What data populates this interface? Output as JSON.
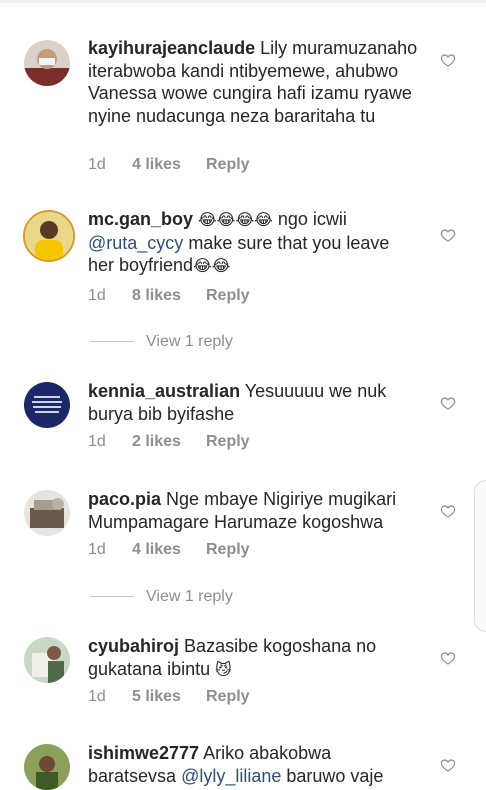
{
  "comments": [
    {
      "username": "kayihurajeanclaude",
      "segments": [
        "Lily muramuzanaho iterabwoba kandi ntibyemewe, ahubwo Vanessa wowe cungira hafi izamu ryawe nyine nudacunga neza bararitaha tu"
      ],
      "time": "1d",
      "likes": "4 likes",
      "reply": "Reply",
      "avatar_color": "#b9b1a6"
    },
    {
      "username": "mc.gan_boy",
      "emoji_a": "😂😂😂😂",
      "text_a": " ngo icwii ",
      "mention": "@ruta_cycy",
      "text_b": " make sure that you leave her boyfriend",
      "emoji_b": "😂😂",
      "time": "1d",
      "likes": "8 likes",
      "reply": "Reply",
      "avatar_color": "#f5c518"
    },
    {
      "username": "kennia_australian",
      "text": "Yesuuuuu we nuk burya bib byifashe",
      "time": "1d",
      "likes": "2 likes",
      "reply": "Reply",
      "avatar_color": "#1b2766"
    },
    {
      "username": "paco.pia",
      "text": "Nge mbaye Nigiriye  mugikari Mumpamagare Harumaze  kogoshwa",
      "time": "1d",
      "likes": "4 likes",
      "reply": "Reply",
      "avatar_color": "#8c8f95"
    },
    {
      "username": "cyubahiroj",
      "text": "Bazasibe kogoshana no gukatana ibintu ",
      "emoji": "😼",
      "time": "1d",
      "likes": "5 likes",
      "reply": "Reply",
      "avatar_color": "#9fb8a0"
    },
    {
      "username": "ishimwe2777",
      "text_a": "Ariko abakobwa baratsevsa ",
      "mention": "@lyly_liliane",
      "text_b": " baruwo vaje",
      "avatar_color": "#6c7a3a"
    }
  ],
  "view_replies": [
    "View 1 reply",
    "View 1 reply"
  ],
  "icons": {
    "like": "heart-outline-icon"
  },
  "colors": {
    "text": "#262626",
    "meta": "#8e8e8e",
    "mention": "#2f4f78"
  }
}
